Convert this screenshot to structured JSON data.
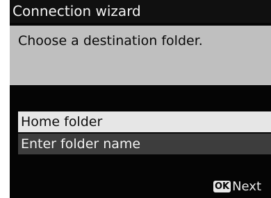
{
  "title": "Connection wizard",
  "message": "Choose a destination folder.",
  "options": [
    {
      "label": "Home folder",
      "selected": true
    },
    {
      "label": "Enter folder name",
      "selected": false
    }
  ],
  "footer": {
    "button_icon": "OK",
    "action_label": "Next"
  }
}
